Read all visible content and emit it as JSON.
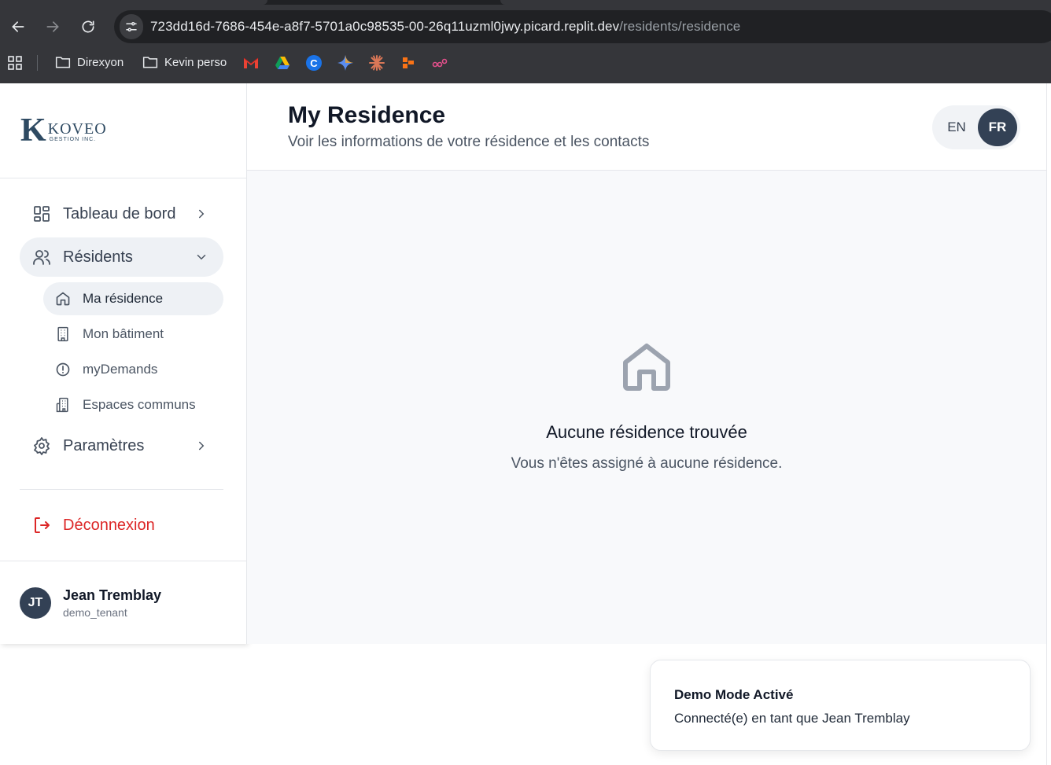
{
  "browser": {
    "url_host": "723dd16d-7686-454e-a8f7-5701a0c98535-00-26q11uzml0jwy.picard.replit.dev",
    "url_path": "/residents/residence",
    "bookmarks": [
      {
        "label": "Direxyon",
        "icon": "folder-icon"
      },
      {
        "label": "Kevin perso",
        "icon": "folder-icon"
      }
    ],
    "favicons": [
      "gmail-icon",
      "google-drive-icon",
      "c-icon",
      "gemini-icon",
      "claude-icon",
      "figma-like-icon",
      "link-icon"
    ]
  },
  "brand": {
    "logo_letter": "K",
    "logo_name": "KOVEO",
    "logo_sub": "GESTION INC.",
    "color": "#2e4a62"
  },
  "sidebar": {
    "items": [
      {
        "label": "Tableau de bord",
        "icon": "dashboard-grid-icon"
      },
      {
        "label": "Résidents",
        "icon": "users-icon"
      },
      {
        "label": "Paramètres",
        "icon": "gear-icon"
      }
    ],
    "sub_items": [
      {
        "label": "Ma résidence",
        "icon": "home-icon"
      },
      {
        "label": "Mon bâtiment",
        "icon": "building-icon"
      },
      {
        "label": "myDemands",
        "icon": "alert-circle-icon"
      },
      {
        "label": "Espaces communs",
        "icon": "buildings-icon"
      }
    ],
    "logout": "Déconnexion",
    "user": {
      "initials": "JT",
      "name": "Jean Tremblay",
      "username": "demo_tenant"
    }
  },
  "header": {
    "title": "My Residence",
    "subtitle": "Voir les informations de votre résidence et les contacts",
    "lang_en": "EN",
    "lang_fr": "FR",
    "active_lang": "FR"
  },
  "empty_state": {
    "icon": "home-icon",
    "title": "Aucune résidence trouvée",
    "message": "Vous n'êtes assigné à aucune résidence."
  },
  "toast": {
    "title": "Demo Mode Activé",
    "body": "Connecté(e) en tant que Jean Tremblay"
  },
  "colors": {
    "accent": "#334155",
    "danger": "#dc2626",
    "active_bg": "#eef1f5",
    "main_bg": "#f8f9fb"
  }
}
